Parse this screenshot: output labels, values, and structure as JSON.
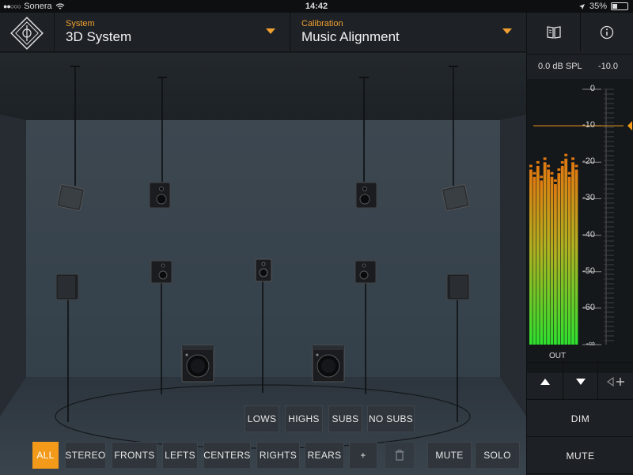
{
  "status_bar": {
    "carrier": "Sonera",
    "time": "14:42",
    "battery": "35%"
  },
  "header": {
    "system": {
      "caption": "System",
      "value": "3D System"
    },
    "calibration": {
      "caption": "Calibration",
      "value": "Music Alignment"
    }
  },
  "filters": {
    "top_row": [
      "LOWS",
      "HIGHS",
      "SUBS",
      "NO SUBS"
    ],
    "bottom_row": [
      "ALL",
      "STEREO",
      "FRONTS",
      "LEFTS",
      "CENTERS",
      "RIGHTS",
      "REARS",
      "+"
    ],
    "active": "ALL",
    "mute": "MUTE",
    "solo": "SOLO"
  },
  "meter": {
    "spl_readout": "0.0 dB SPL",
    "level_readout": "-10.0",
    "scale": [
      "0",
      "-10",
      "-20",
      "-30",
      "-40",
      "-50",
      "-60",
      "-∞"
    ],
    "fader_db": -10,
    "label": "OUT",
    "channels": 14
  },
  "panel": {
    "dim": "DIM",
    "mute": "MUTE"
  },
  "colors": {
    "accent": "#f39a1a",
    "meter_green": "#2ee02e",
    "meter_orange": "#e07a10"
  },
  "icons": {
    "manual": "book-icon",
    "info": "info-icon",
    "up": "arrow-up-icon",
    "down": "arrow-down-icon",
    "add": "add-speaker-icon",
    "delete": "trash-icon"
  }
}
